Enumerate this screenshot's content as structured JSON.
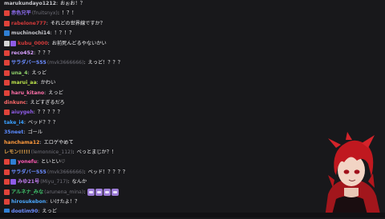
{
  "messages": [
    {
      "user": "marukundayo1212",
      "login": "",
      "colon": ":",
      "text": " おぉお！？",
      "color": "#c9c9cf",
      "badges": []
    },
    {
      "user": "赤色兄平",
      "login": " (fruitsnyx)",
      "colon": ":",
      "text": "！？！",
      "color": "#8c6cf0",
      "badges": [
        "#e0433a"
      ]
    },
    {
      "user": "rabelone777",
      "login": "",
      "colon": ":",
      "text": "それどの世界線ですか？",
      "color": "#d23a3a",
      "badges": [
        "#e0433a"
      ]
    },
    {
      "user": "muchinochi14",
      "login": "",
      "colon": ":",
      "text": "！？！？",
      "color": "#c9c9cf",
      "badges": [
        "#2f7fd4"
      ]
    },
    {
      "user": "kubu_0000",
      "login": "",
      "colon": ":",
      "text": "お前死んどるやないかい",
      "color": "#d23a3a",
      "badges": [
        "#d5d5d5",
        "#8e5be6"
      ]
    },
    {
      "user": "reco452",
      "login": "",
      "colon": ":",
      "text": "？？？",
      "color": "#d8a0ff",
      "badges": [
        "#e0433a"
      ]
    },
    {
      "user": "サラダバー555",
      "login": " (mvk3666666)",
      "colon": ":",
      "text": "えっど！？？？",
      "color": "#6b8cff",
      "badges": [
        "#e0433a"
      ]
    },
    {
      "user": "una_4",
      "login": "",
      "colon": ":",
      "text": "えっど",
      "color": "#8fd16a",
      "badges": [
        "#e0433a"
      ]
    },
    {
      "user": "marui_aa",
      "login": "",
      "colon": ":",
      "text": "かわい",
      "color": "#b9e04a",
      "badges": [
        "#e0433a"
      ]
    },
    {
      "user": "haru_kitano",
      "login": "",
      "colon": ":",
      "text": "えっど",
      "color": "#ff6fa8",
      "badges": [
        "#e0433a"
      ]
    },
    {
      "user": "dinkunc",
      "login": "",
      "colon": ":",
      "text": "えどすぎるだろ",
      "color": "#ff6a6a",
      "badges": []
    },
    {
      "user": "aiuygeh",
      "login": "",
      "colon": ":",
      "text": "？？？？？",
      "color": "#8e5be6",
      "badges": [
        "#e0433a"
      ]
    },
    {
      "user": "take_i4",
      "login": "",
      "colon": ":",
      "text": "ベッド？？？",
      "color": "#3aa0ff",
      "badges": []
    },
    {
      "user": "35neet",
      "login": "",
      "colon": ":",
      "text": "ゴール",
      "color": "#5a8aff",
      "badges": []
    },
    {
      "user": "hanchama12",
      "login": "",
      "colon": ":",
      "text": "エロゲやめて",
      "color": "#ff9a3c",
      "badges": []
    },
    {
      "user": "レモン!!!!!",
      "login": " (lemonnice_112)",
      "colon": ":",
      "text": "べっとまじか？！",
      "color": "#e6a64a",
      "badges": []
    },
    {
      "user": "yonefu",
      "login": "",
      "colon": ":",
      "text": "といとい♡",
      "color": "#ff5ab4",
      "badges": [
        "#e0433a",
        "#2f7fd4"
      ]
    },
    {
      "user": "サラダバー555",
      "login": " (mvk3666666)",
      "colon": ":",
      "text": "ベッド！？？？？",
      "color": "#6b8cff",
      "badges": [
        "#e0433a"
      ]
    },
    {
      "user": "みゆ21号",
      "login": " (Miyu_717)",
      "colon": ":",
      "text": "なんか",
      "color": "#c07cf0",
      "badges": [
        "#e0433a",
        "#8e5be6"
      ]
    },
    {
      "user": "アルネナ_みな",
      "login": " (arunena_mina)",
      "colon": ":",
      "text": "",
      "color": "#3fbf6a",
      "badges": [
        "#e0433a"
      ],
      "emotes": 4
    },
    {
      "user": "hirosukebon",
      "login": "",
      "colon": ":",
      "text": "いけたよ！？",
      "color": "#4aa8ff",
      "badges": [
        "#e0433a"
      ]
    },
    {
      "user": "dogtim90",
      "login": "",
      "colon": ":",
      "text": "えっど",
      "color": "#6a8cff",
      "badges": [
        "#2f7fd4"
      ]
    }
  ],
  "colors": {
    "background": "#18181b",
    "message_text": "#efeff1",
    "login_text": "#6f6f78"
  },
  "icons": {
    "badge": "subscriber-badge",
    "emote": "emote-icon",
    "avatar": "vtuber-avatar"
  }
}
